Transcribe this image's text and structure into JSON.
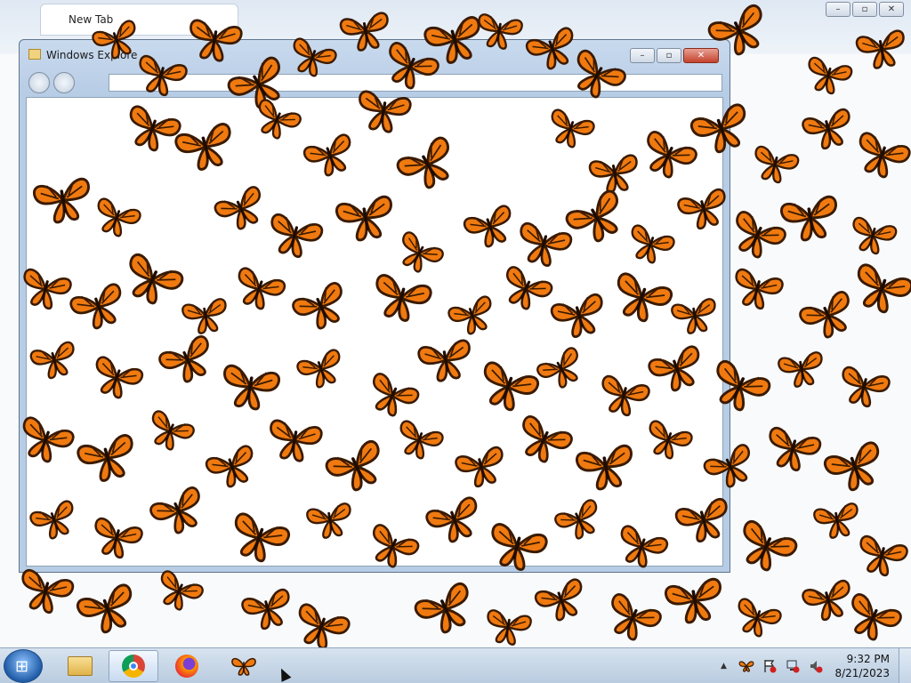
{
  "browser": {
    "tab_label": "New Tab",
    "minimize_label": "–",
    "maximize_label": "▫",
    "close_label": "✕"
  },
  "explorer": {
    "title": "Windows Explore",
    "minimize_label": "–",
    "maximize_label": "▫",
    "close_label": "✕"
  },
  "taskbar": {
    "start_glyph": "⊞",
    "items": [
      {
        "name": "windows-explorer",
        "icon": "folder-icon",
        "active": false
      },
      {
        "name": "google-chrome",
        "icon": "chrome-icon",
        "active": true
      },
      {
        "name": "firefox",
        "icon": "firefox-icon",
        "active": false
      },
      {
        "name": "butterfly-app",
        "icon": "butterfly-icon",
        "active": false
      }
    ],
    "tray": {
      "show_hidden_glyph": "▲",
      "time": "9:32 PM",
      "date": "8/21/2023"
    }
  },
  "colors": {
    "butterfly_wing": "#f07a10",
    "butterfly_vein": "#3a1a00",
    "start_orb": "#1f5ba6"
  }
}
